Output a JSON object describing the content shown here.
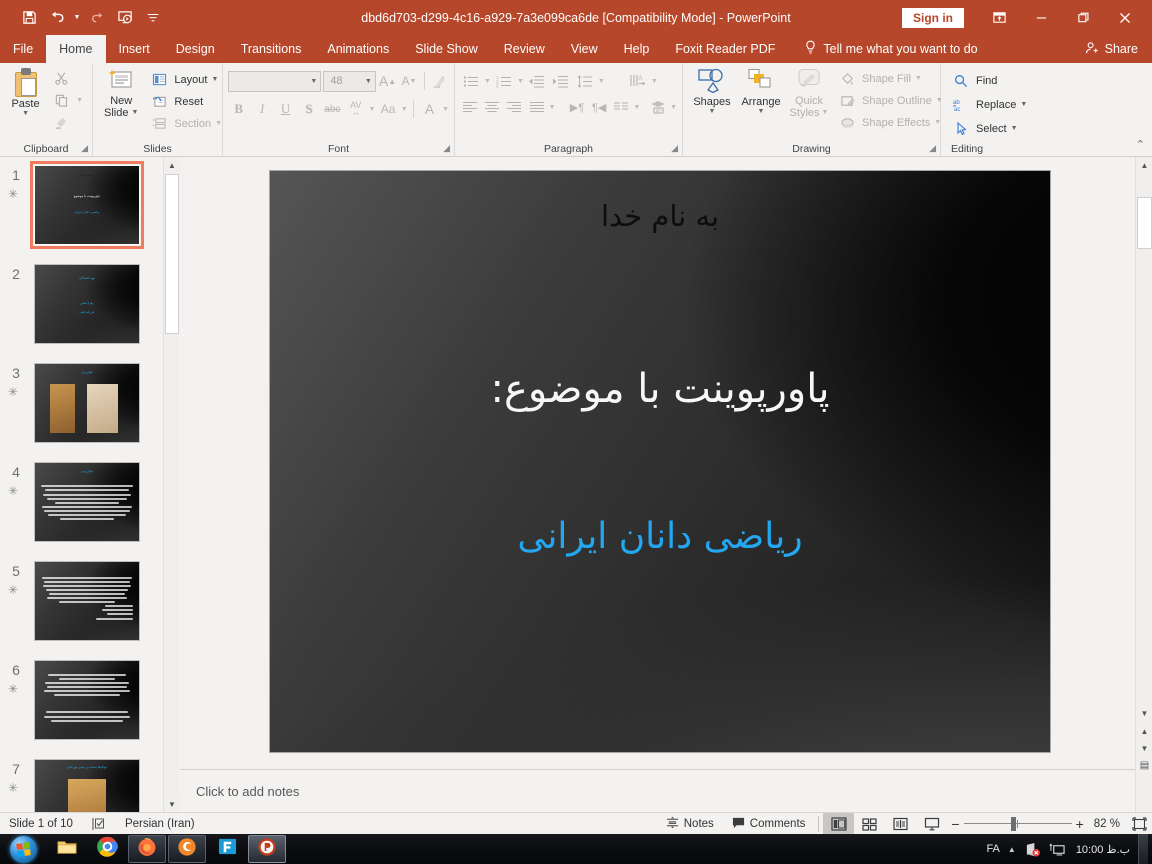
{
  "window": {
    "title": "dbd6d703-d299-4c16-a929-7a3e099ca6de [Compatibility Mode]  -  PowerPoint",
    "signin_label": "Sign in",
    "quick_access": [
      {
        "name": "save-icon",
        "label": "Save"
      },
      {
        "name": "undo-icon",
        "label": "Undo"
      },
      {
        "name": "redo-icon",
        "label": "Redo"
      },
      {
        "name": "start-presentation-icon",
        "label": "Start From Beginning"
      },
      {
        "name": "customize-qat-icon",
        "label": "Customize Quick Access Toolbar"
      }
    ],
    "controls": {
      "ribbon_display": "Ribbon Display Options",
      "minimize": "Minimize",
      "restore": "Restore Down",
      "close": "Close"
    }
  },
  "tabs": [
    {
      "label": "File",
      "active": false
    },
    {
      "label": "Home",
      "active": true
    },
    {
      "label": "Insert",
      "active": false
    },
    {
      "label": "Design",
      "active": false
    },
    {
      "label": "Transitions",
      "active": false
    },
    {
      "label": "Animations",
      "active": false
    },
    {
      "label": "Slide Show",
      "active": false
    },
    {
      "label": "Review",
      "active": false
    },
    {
      "label": "View",
      "active": false
    },
    {
      "label": "Help",
      "active": false
    },
    {
      "label": "Foxit Reader PDF",
      "active": false
    }
  ],
  "tellme": "Tell me what you want to do",
  "share_label": "Share",
  "ribbon": {
    "clipboard": {
      "title": "Clipboard",
      "paste": "Paste",
      "cut": "Cut",
      "copy": "Copy",
      "format_painter": "Format Painter"
    },
    "slides": {
      "title": "Slides",
      "new_slide": "New\nSlide",
      "new_slide_line1": "New",
      "new_slide_line2": "Slide",
      "layout": "Layout",
      "reset": "Reset",
      "section": "Section"
    },
    "font": {
      "title": "Font",
      "font_name": "",
      "font_name_placeholder": "",
      "font_size": "48",
      "bold": "B",
      "italic": "I",
      "underline": "U",
      "shadow": "S",
      "strikethrough": "abc",
      "char_spacing": "AV",
      "change_case": "Aa",
      "font_color": "A",
      "clear_formatting": "Clear All Formatting"
    },
    "paragraph": {
      "title": "Paragraph",
      "bullets": "Bullets",
      "numbering": "Numbering",
      "decrease_indent": "Decrease List Level",
      "increase_indent": "Increase List Level",
      "line_spacing": "Line Spacing",
      "align_left": "Align Left",
      "center": "Center",
      "align_right": "Align Right",
      "justify": "Justify",
      "ltr": "Left-to-Right",
      "rtl": "Right-to-Left",
      "columns": "Columns",
      "text_direction": "Text Direction",
      "align_text": "Align Text",
      "smartart": "Convert to SmartArt"
    },
    "drawing": {
      "title": "Drawing",
      "shapes": "Shapes",
      "arrange": "Arrange",
      "quick_styles_line1": "Quick",
      "quick_styles_line2": "Styles",
      "shape_fill": "Shape Fill",
      "shape_outline": "Shape Outline",
      "shape_effects": "Shape Effects"
    },
    "editing": {
      "title": "Editing",
      "find": "Find",
      "replace": "Replace",
      "select": "Select"
    },
    "collapse_label": "Collapse the Ribbon"
  },
  "thumbnails": [
    {
      "number": "1",
      "selected": true,
      "animated": true,
      "lines": [
        {
          "t": "به نام خدا",
          "cls": "dk",
          "top": "9%"
        },
        {
          "t": "پاورپوینت با موضوع:",
          "cls": "",
          "top": "36%"
        },
        {
          "t": "ریاضی دانان ایرانی",
          "cls": "cy",
          "top": "57%"
        }
      ]
    },
    {
      "number": "2",
      "selected": false,
      "animated": false,
      "lines": [
        {
          "t": "تهیه کنندگان",
          "cls": "cy",
          "top": "14%"
        },
        {
          "t": "زهرا اصلی",
          "cls": "cy",
          "top": "46%"
        },
        {
          "t": "فرزانه فخر",
          "cls": "cy",
          "top": "58%"
        }
      ]
    },
    {
      "number": "3",
      "selected": false,
      "animated": true,
      "lines": [
        {
          "t": "خوارزمی",
          "cls": "cy",
          "top": "8%"
        }
      ],
      "images": 2
    },
    {
      "number": "4",
      "selected": false,
      "animated": true,
      "lines": [
        {
          "t": "خوارزمی",
          "cls": "cy",
          "top": "8%"
        }
      ],
      "paragraph": {
        "top": "26%",
        "rows": 9
      }
    },
    {
      "number": "5",
      "selected": false,
      "animated": true,
      "lines": [],
      "paragraph": {
        "top": "18%",
        "rows": 12
      }
    },
    {
      "number": "6",
      "selected": false,
      "animated": true,
      "lines": [],
      "paragraph": {
        "top": "16%",
        "rows": 10
      }
    },
    {
      "number": "7",
      "selected": false,
      "animated": true,
      "lines": [
        {
          "t": "ابوالوفا محمد بن یحیی بوزجانی",
          "cls": "cy",
          "top": "8%"
        }
      ],
      "portrait": true
    }
  ],
  "slide": {
    "bismillah": "به نام خدا",
    "title": "پاورپوینت با موضوع:",
    "subtitle": "ریاضی دانان ایرانی",
    "colors": {
      "title": "#f7f7f7",
      "subtitle": "#22a7f0",
      "bismillah": "#0d0d0d"
    }
  },
  "notes_placeholder": "Click to add notes",
  "status": {
    "slide_counter": "Slide 1 of 10",
    "spellcheck_name": "spell-check-icon",
    "language": "Persian (Iran)",
    "notes_label": "Notes",
    "comments_label": "Comments",
    "views": [
      {
        "name": "normal-view",
        "label": "Normal",
        "active": true
      },
      {
        "name": "slide-sorter-view",
        "label": "Slide Sorter",
        "active": false
      },
      {
        "name": "reading-view",
        "label": "Reading View",
        "active": false
      },
      {
        "name": "slide-show-view",
        "label": "Slide Show",
        "active": false
      }
    ],
    "zoom_out": "−",
    "zoom_in": "+",
    "zoom_level": "82 %",
    "fit_label": "Fit slide to current window"
  },
  "taskbar": {
    "start_label": "Start",
    "apps": [
      {
        "name": "file-explorer-icon",
        "label": "File Explorer",
        "framed": false,
        "active": false
      },
      {
        "name": "chrome-icon",
        "label": "Google Chrome",
        "framed": false,
        "active": false
      },
      {
        "name": "firefox-icon",
        "label": "Mozilla Firefox",
        "framed": true,
        "active": false
      },
      {
        "name": "edge-legacy-icon",
        "label": "Browser",
        "framed": true,
        "active": false
      },
      {
        "name": "foxit-icon",
        "label": "Foxit Reader",
        "framed": false,
        "active": false
      },
      {
        "name": "powerpoint-icon",
        "label": "PowerPoint",
        "framed": true,
        "active": true
      }
    ],
    "tray": {
      "language": "FA",
      "show_hidden": "Show hidden icons",
      "network_name": "network-error-icon",
      "display_name": "display-icon",
      "clock": "10:00 ب.ظ"
    }
  }
}
